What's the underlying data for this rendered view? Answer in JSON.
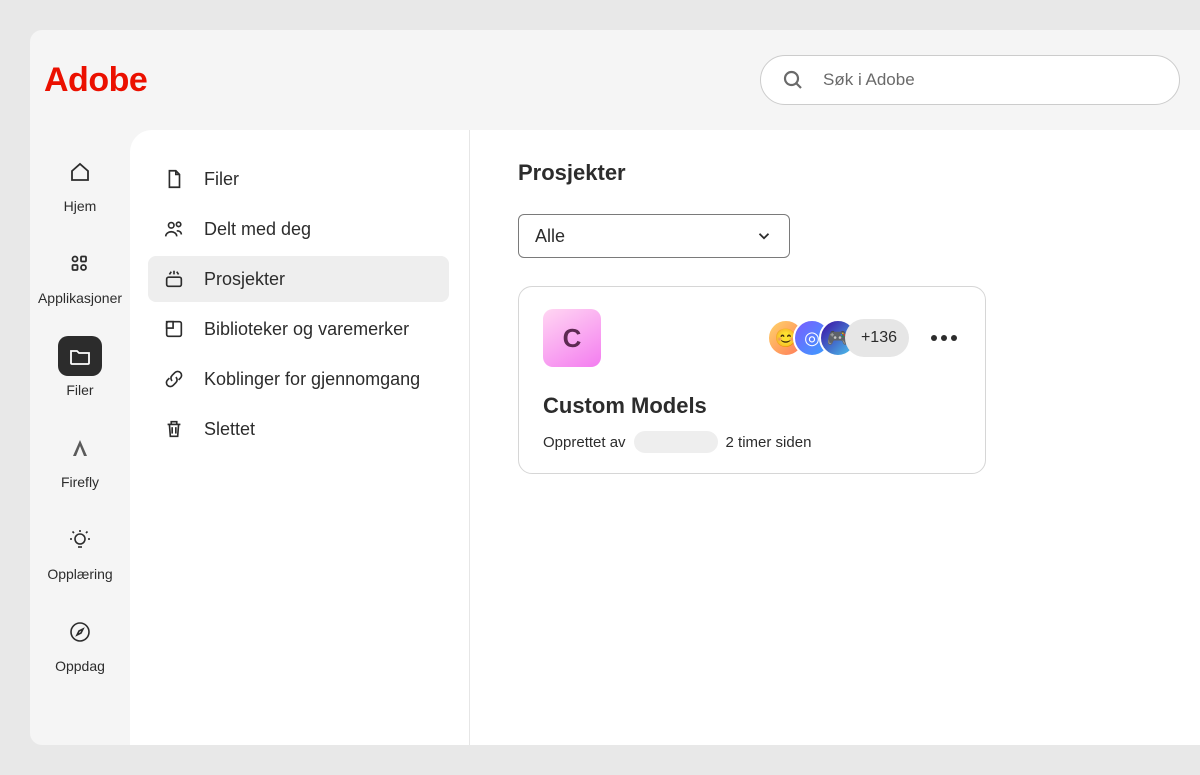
{
  "brand": "Adobe",
  "search": {
    "placeholder": "Søk i Adobe"
  },
  "rail": {
    "items": [
      {
        "key": "home",
        "label": "Hjem"
      },
      {
        "key": "apps",
        "label": "Applikasjoner"
      },
      {
        "key": "files",
        "label": "Filer"
      },
      {
        "key": "firefly",
        "label": "Firefly"
      },
      {
        "key": "learn",
        "label": "Opplæring"
      },
      {
        "key": "discover",
        "label": "Oppdag"
      }
    ],
    "active": "files"
  },
  "sidebar": {
    "items": [
      {
        "key": "files",
        "label": "Filer"
      },
      {
        "key": "shared",
        "label": "Delt med deg"
      },
      {
        "key": "projects",
        "label": "Prosjekter"
      },
      {
        "key": "libraries",
        "label": "Biblioteker og varemerker"
      },
      {
        "key": "reviews",
        "label": "Koblinger for gjennomgang"
      },
      {
        "key": "deleted",
        "label": "Slettet"
      }
    ],
    "active": "projects"
  },
  "main": {
    "title": "Prosjekter",
    "filter": {
      "selected": "Alle"
    },
    "project": {
      "thumb_letter": "C",
      "name": "Custom Models",
      "created_by_label": "Opprettet av",
      "time_ago": "2 timer siden",
      "extra_members": "+136"
    }
  }
}
